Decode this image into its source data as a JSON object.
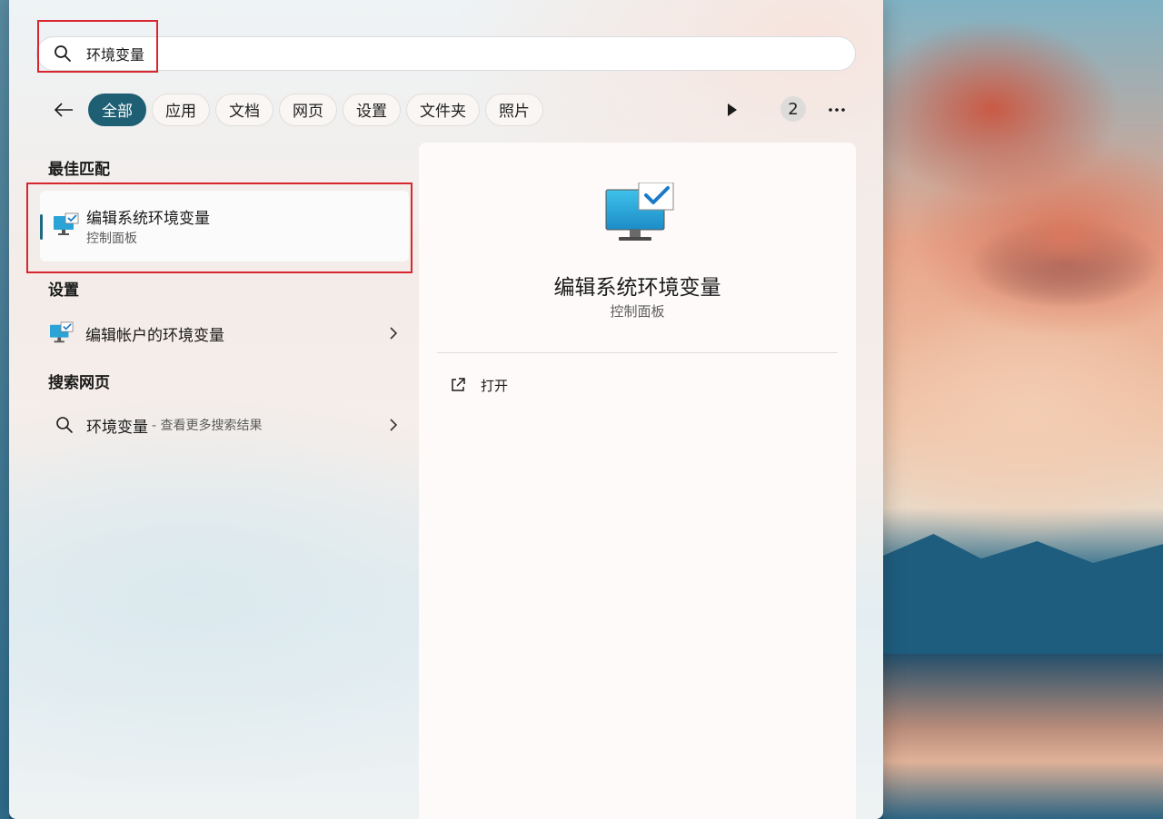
{
  "search": {
    "query": "环境变量",
    "icon": "search-icon"
  },
  "filters": {
    "back_icon": "back-arrow-icon",
    "chips": [
      {
        "label": "全部",
        "active": true
      },
      {
        "label": "应用",
        "active": false
      },
      {
        "label": "文档",
        "active": false
      },
      {
        "label": "网页",
        "active": false
      },
      {
        "label": "设置",
        "active": false
      },
      {
        "label": "文件夹",
        "active": false
      },
      {
        "label": "照片",
        "active": false
      }
    ],
    "play_icon": "play-icon",
    "count": "2",
    "more_icon": "more-icon"
  },
  "results": {
    "best_match_title": "最佳匹配",
    "best_match": {
      "title": "编辑系统环境变量",
      "subtitle": "控制面板",
      "icon": "monitor-check-icon"
    },
    "settings_title": "设置",
    "settings_item": {
      "label": "编辑帐户的环境变量",
      "icon": "monitor-check-icon"
    },
    "web_title": "搜索网页",
    "web_item": {
      "label": "环境变量",
      "desc": "- 查看更多搜索结果",
      "icon": "search-icon"
    }
  },
  "detail": {
    "title": "编辑系统环境变量",
    "subtitle": "控制面板",
    "action_label": "打开",
    "action_icon": "open-external-icon"
  },
  "colors": {
    "accent": "#1e5f73",
    "highlight": "#d9262e"
  }
}
